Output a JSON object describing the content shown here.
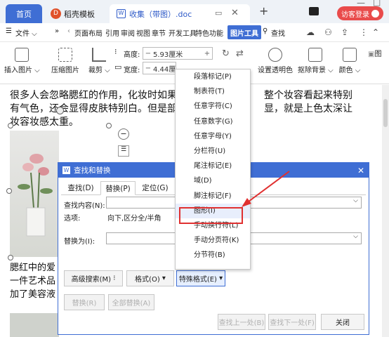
{
  "tabs": {
    "home": "首页",
    "daoke": "稻壳模板",
    "doc": "收集（带图）.doc"
  },
  "login": "访客登录",
  "menu": {
    "file": "文件",
    "items": [
      "页面布局",
      "引用",
      "审阅",
      "视图",
      "章节",
      "开发工具",
      "特色功能",
      "图片工具"
    ],
    "search": "查找"
  },
  "ribbon": {
    "insert_pic": "插入图片",
    "compress": "压缩图片",
    "crop": "裁剪",
    "height_label": "高度:",
    "height_value": "5.93厘米",
    "width_label": "宽度:",
    "width_value": "4.44厘米",
    "transparent": "设置透明色",
    "remove_bg": "抠除背景",
    "color": "颜色",
    "more": "图"
  },
  "doc": {
    "line1": "很多人会忽略腮红的作用，化妆时如果腮",
    "line1b": "整个妆容看起来特别",
    "line2": "有气色，还会显得皮肤特别白。但是部分",
    "line2b": "显，就是上色太深让",
    "line3": "妆容妆感太重。",
    "para2_1": "腮红中的爱",
    "para2_2": "一件艺术品",
    "para2_3": "加了美容液"
  },
  "dialog": {
    "title": "查找和替换",
    "tabs": [
      "查找(D)",
      "替换(P)",
      "定位(G)"
    ],
    "find_label": "查找内容(N):",
    "options_label": "选项:",
    "options_value": "向下,区分全/半角",
    "replace_label": "替换为(I):",
    "advanced": "高级搜索(M)",
    "format": "格式(O)",
    "special": "特殊格式(E)",
    "replace_btn": "替换(R)",
    "replace_all": "全部替换(A)",
    "find_prev": "查找上一处(B)",
    "find_next": "查找下一处(F)",
    "close": "关闭"
  },
  "dropdown": [
    "段落标记(P)",
    "制表符(T)",
    "任意字符(C)",
    "任意数字(G)",
    "任意字母(Y)",
    "分栏符(U)",
    "尾注标记(E)",
    "域(D)",
    "脚注标记(F)",
    "图形(I)",
    "手动换行符(L)",
    "手动分页符(K)",
    "分节符(B)"
  ],
  "colors": {
    "accent": "#3f6ed4",
    "highlight": "#e03030"
  }
}
